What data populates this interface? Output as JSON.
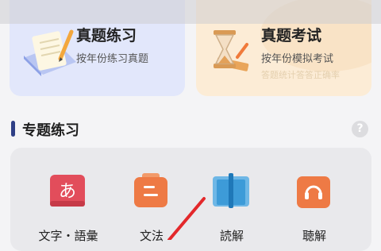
{
  "cards": [
    {
      "title": "真题练习",
      "subtitle": "按年份练习真题",
      "icon": "paper-pen-icon"
    },
    {
      "title": "真题考试",
      "subtitle": "按年份模拟考试",
      "extra": "答题统计答答正确率",
      "icon": "hourglass-icon"
    }
  ],
  "section": {
    "title": "专题练习",
    "help": "?"
  },
  "topics": [
    {
      "label": "文字・語彙",
      "icon": "kana-icon",
      "glyph": "あ",
      "color": "#e24d5b"
    },
    {
      "label": "文法",
      "icon": "grammar-icon",
      "color": "#ee7a45"
    },
    {
      "label": "読解",
      "icon": "book-icon",
      "color": "#3d9bd8"
    },
    {
      "label": "聴解",
      "icon": "headphones-icon",
      "color": "#ee7a45"
    }
  ]
}
